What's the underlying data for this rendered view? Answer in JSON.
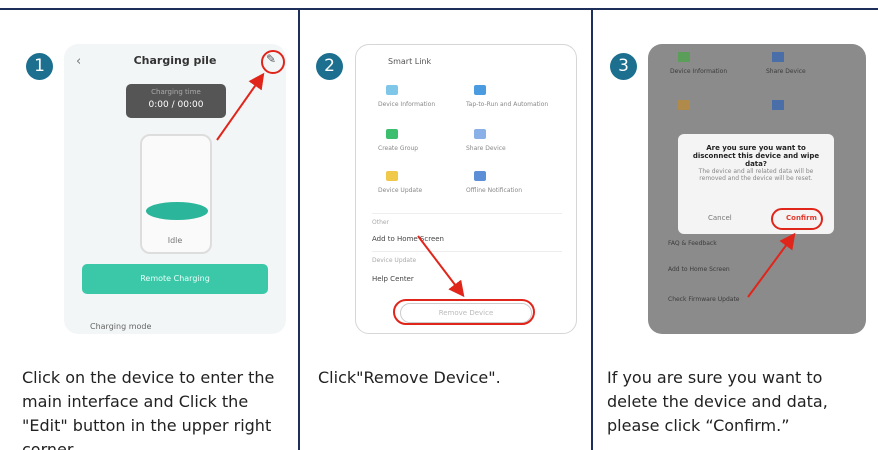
{
  "steps": [
    {
      "number": "1",
      "caption": "Click on the device to enter the main interface and Click the \"Edit\" button in the upper right corner.",
      "screen": {
        "back_icon": "back-chevron-icon",
        "title": "Charging pile",
        "edit_icon": "edit-pencil-icon",
        "time_label": "Charging time",
        "time_value": "0:00 / 00:00",
        "status": "Idle",
        "button_label": "Remote Charging",
        "bottom_label": "Charging mode"
      }
    },
    {
      "number": "2",
      "caption": "Click\"Remove Device\".",
      "screen": {
        "header": "Smart Link",
        "options": [
          "Device Information",
          "Tap-to-Run and Automation",
          "Create Group",
          "Share Device",
          "Device Update",
          "Offline Notification"
        ],
        "section1": "Other",
        "row1": "Add to Home Screen",
        "section2": "Device Update",
        "row2": "Help Center",
        "remove_label": "Remove Device"
      }
    },
    {
      "number": "3",
      "caption": "If you are sure you want to delete the device and data, please click “Confirm.”",
      "screen": {
        "dialog_title": "Are you sure you want to disconnect this device and wipe data?",
        "dialog_desc": "The device and all related data will be removed and the device will be reset.",
        "cancel_label": "Cancel",
        "confirm_label": "Confirm",
        "bg_rows": [
          "Device Information",
          "Share Device",
          "FAQ & Feedback",
          "Add to Home Screen",
          "Check Firmware Update"
        ]
      }
    }
  ],
  "colors": {
    "step_circle": "#1c6f8f",
    "divider": "#1d2f5a",
    "highlight": "#e0251b",
    "accent_teal": "#3bc8a9"
  }
}
